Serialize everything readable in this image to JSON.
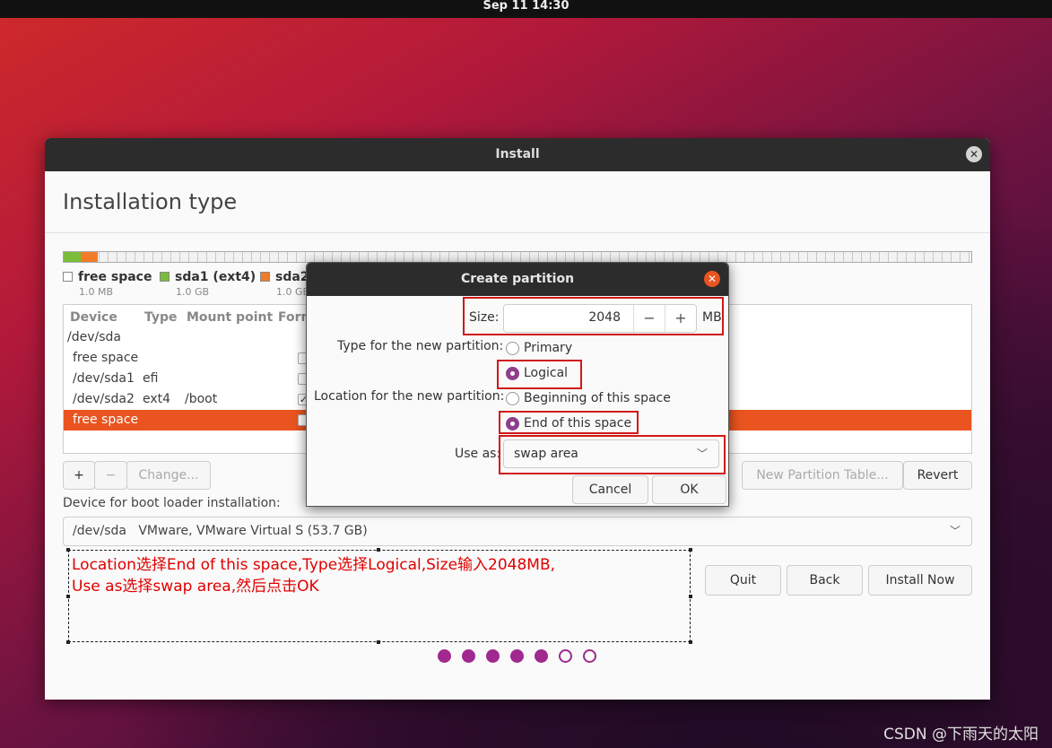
{
  "topbar": {
    "datetime": "Sep 11  14:30"
  },
  "window": {
    "title": "Install",
    "close": "✕",
    "page_title": "Installation type"
  },
  "legend": [
    {
      "name": "free space",
      "size": "1.0 MB",
      "color": "#ffffff"
    },
    {
      "name": "sda1 (ext4)",
      "size": "1.0 GB",
      "color": "#7bbd3a"
    },
    {
      "name": "sda2",
      "size": "1.0 GB",
      "color": "#f07c27"
    }
  ],
  "table": {
    "headers": [
      "Device",
      "Type",
      "Mount point",
      "Form"
    ],
    "rows": [
      {
        "device": "/dev/sda",
        "type": "",
        "mount": ""
      },
      {
        "device": "free space",
        "type": "",
        "mount": ""
      },
      {
        "device": "/dev/sda1",
        "type": "efi",
        "mount": ""
      },
      {
        "device": "/dev/sda2",
        "type": "ext4",
        "mount": "/boot",
        "checked": "✓"
      },
      {
        "device": "free space",
        "type": "",
        "mount": ""
      }
    ]
  },
  "toolbar": {
    "add": "+",
    "remove": "−",
    "change": "Change...",
    "new_table": "New Partition Table...",
    "revert": "Revert"
  },
  "bootloader": {
    "label": "Device for boot loader installation:",
    "device": "/dev/sda",
    "description": "VMware, VMware Virtual S (53.7 GB)"
  },
  "annotation": {
    "line1": "Location选择End of this space,Type选择Logical,Size输入2048MB,",
    "line2": "Use as选择swap area,然后点击OK"
  },
  "nav": {
    "quit": "Quit",
    "back": "Back",
    "install": "Install Now"
  },
  "progress": {
    "total_steps": 7,
    "completed_steps": 5
  },
  "dialog": {
    "title": "Create partition",
    "close": "✕",
    "size_label": "Size:",
    "size_value": "2048",
    "size_unit": "MB",
    "minus": "−",
    "plus": "+",
    "type_label": "Type for the new partition:",
    "type_primary": "Primary",
    "type_logical": "Logical",
    "location_label": "Location for the new partition:",
    "location_begin": "Beginning of this space",
    "location_end": "End of this space",
    "use_as_label": "Use as:",
    "use_as_value": "swap area",
    "cancel": "Cancel",
    "ok": "OK"
  },
  "watermark": "CSDN @下雨天的太阳"
}
